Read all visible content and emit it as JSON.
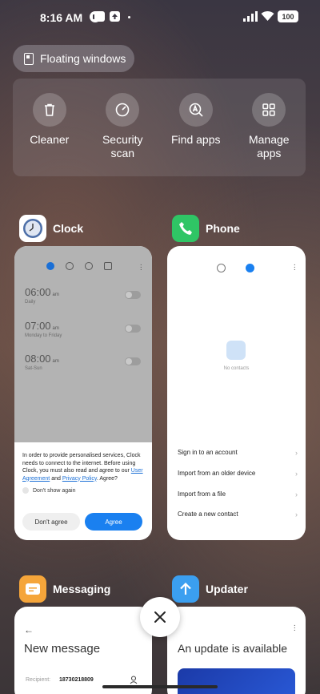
{
  "status_bar": {
    "time": "8:16 AM",
    "battery": "100"
  },
  "floating_windows": {
    "label": "Floating windows"
  },
  "quick_actions": [
    {
      "label": "Cleaner",
      "icon": "trash-icon"
    },
    {
      "label": "Security scan",
      "icon": "security-gauge-icon"
    },
    {
      "label": "Find apps",
      "icon": "find-apps-icon"
    },
    {
      "label": "Manage apps",
      "icon": "grid-icon"
    }
  ],
  "apps": {
    "clock": {
      "name": "Clock",
      "alarms": [
        {
          "time": "06:00",
          "ampm": "am",
          "desc": "Daily"
        },
        {
          "time": "07:00",
          "ampm": "am",
          "desc": "Monday to Friday"
        },
        {
          "time": "08:00",
          "ampm": "am",
          "desc": "Sat-Sun"
        }
      ],
      "consent": {
        "text_1": "In order to provide personalised services, Clock needs to connect to the internet. Before using Clock, you must also read and agree to our ",
        "link_1": "User Agreement",
        "text_2": " and ",
        "link_2": "Privacy Policy",
        "text_3": ". Agree?",
        "dont_show": "Don't show again",
        "disagree": "Don't agree",
        "agree": "Agree"
      }
    },
    "phone": {
      "name": "Phone",
      "empty": "No contacts",
      "actions": [
        "Sign in to an account",
        "Import from an older device",
        "Import from a file",
        "Create a new contact"
      ]
    },
    "messaging": {
      "name": "Messaging",
      "title": "New message",
      "recipient_label": "Recipient:",
      "recipient_value": "18730218809"
    },
    "updater": {
      "name": "Updater",
      "title": "An update is available"
    }
  },
  "colors": {
    "accent": "#1a80f0",
    "phone_green": "#2fc565",
    "messaging_orange": "#f5a53a",
    "updater_blue": "#3b9ff0"
  }
}
